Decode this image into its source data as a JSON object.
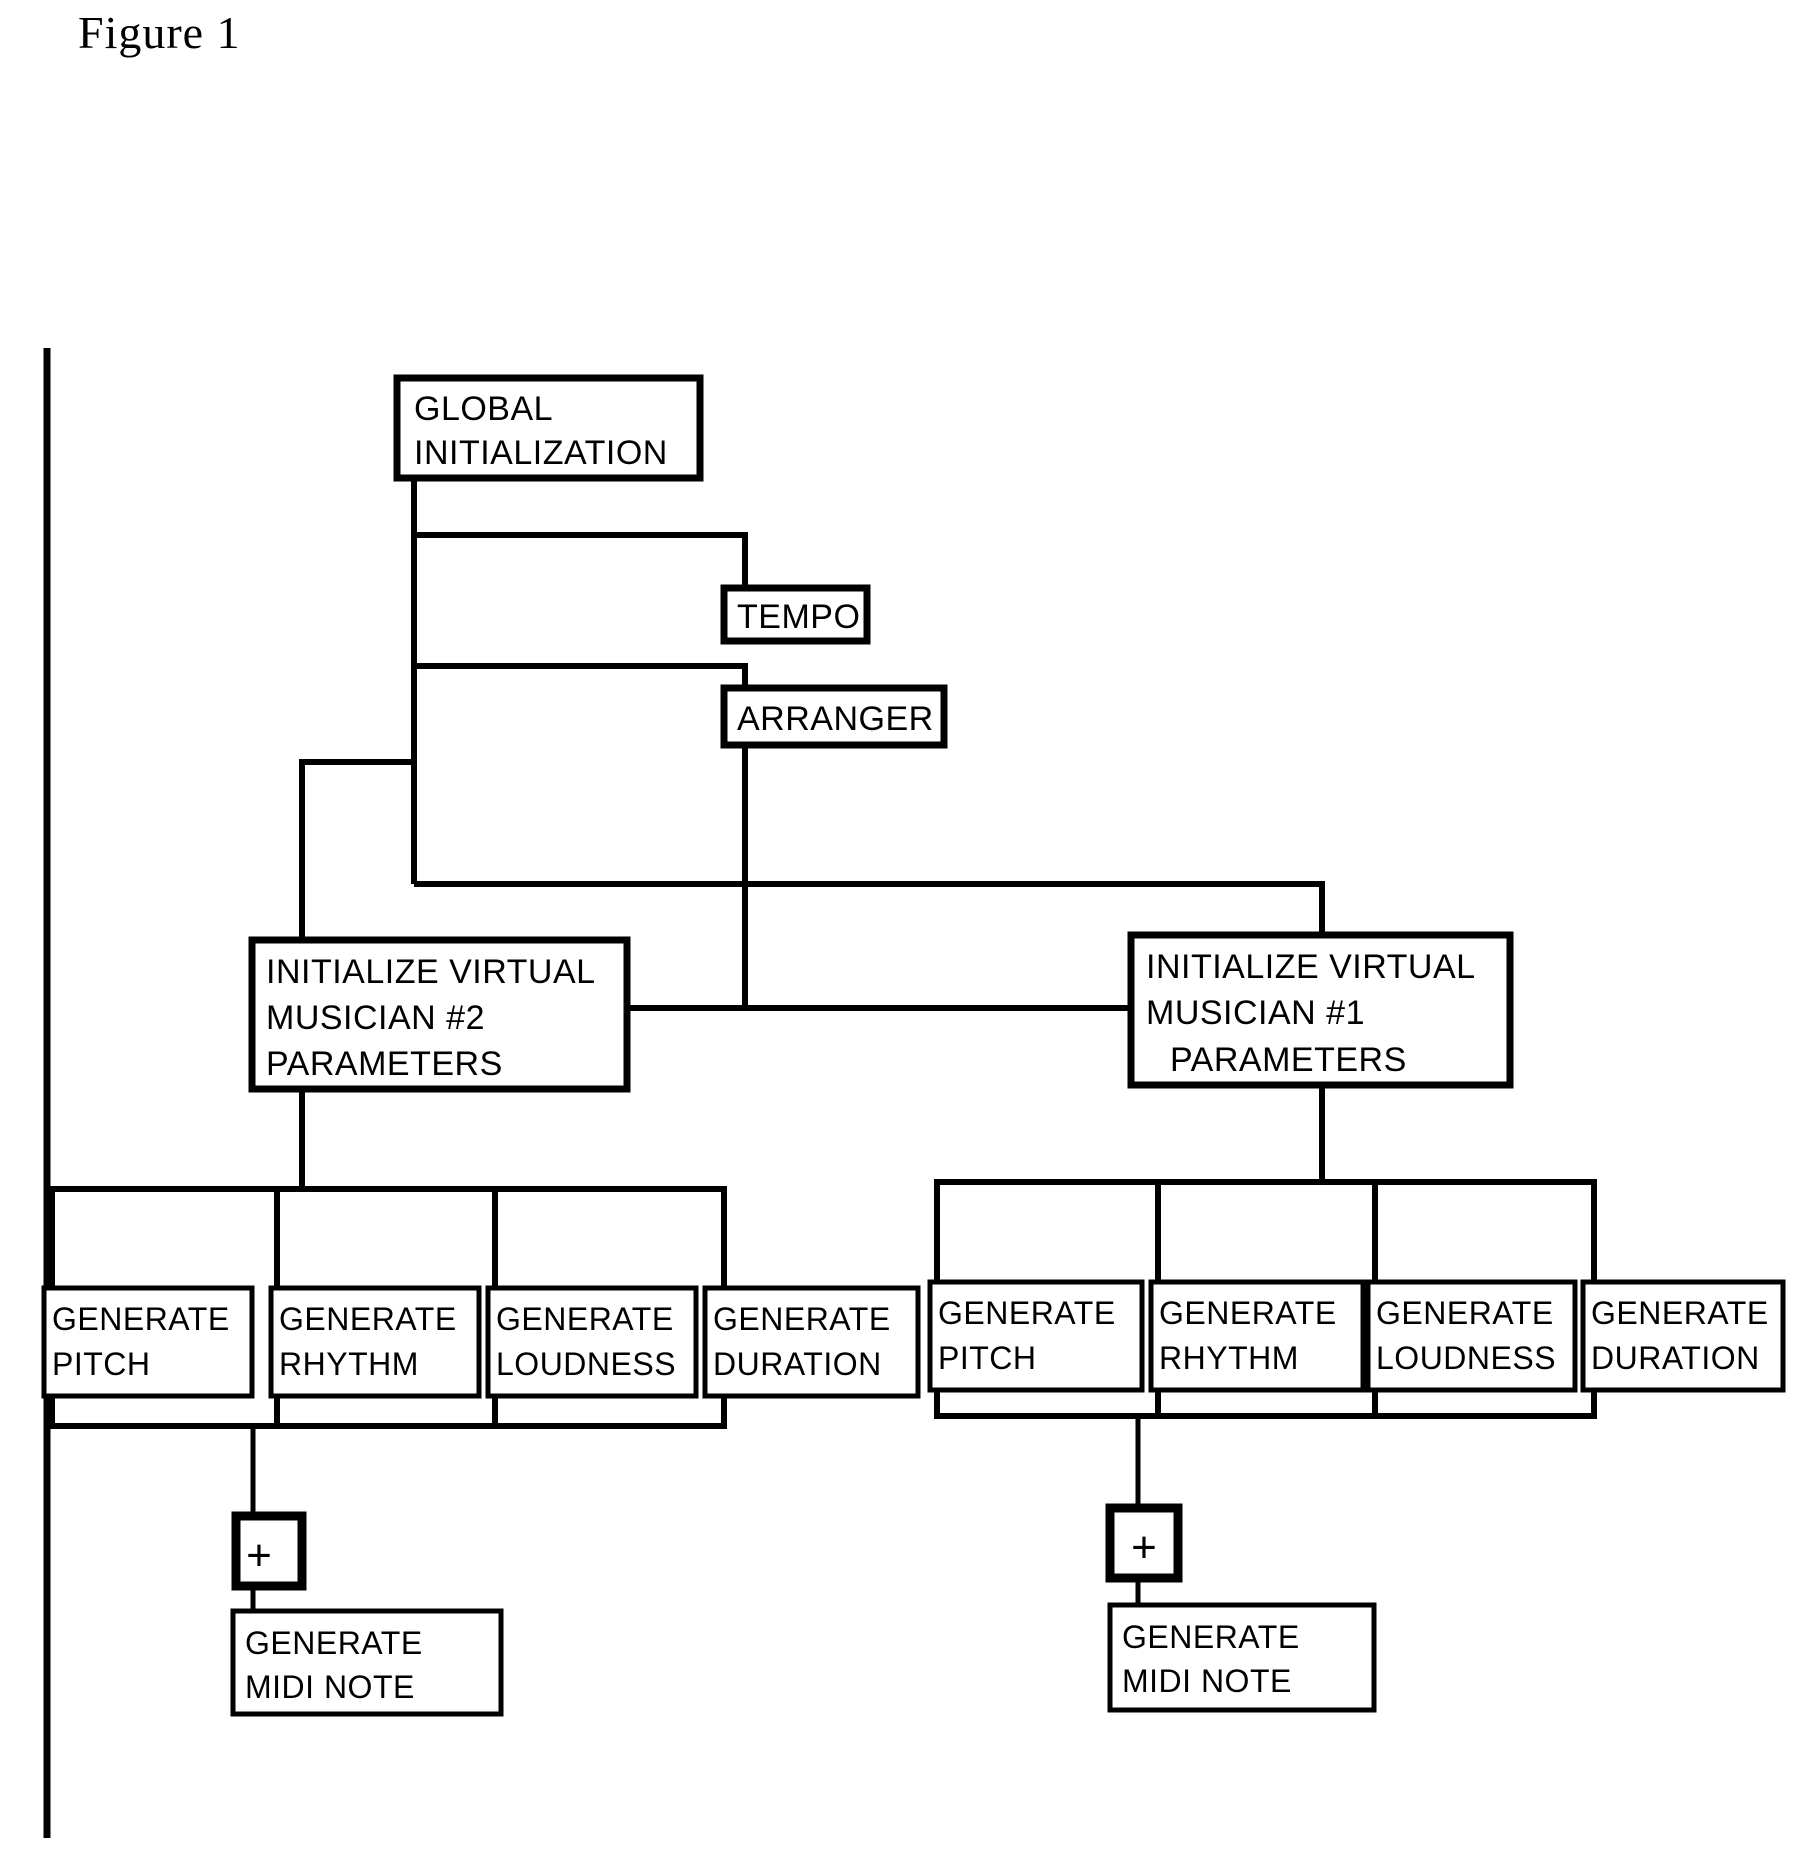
{
  "figure": {
    "title": "Figure 1",
    "ink_color": "#000000",
    "background_color": "#ffffff"
  },
  "nodes": {
    "global_initialization": {
      "line1": "GLOBAL",
      "line2": "INITIALIZATION"
    },
    "tempo": {
      "label": "TEMPO"
    },
    "arranger": {
      "label": "ARRANGER"
    },
    "init_vm2": {
      "line1": "INITIALIZE VIRTUAL",
      "line2": "MUSICIAN #2",
      "line3": "PARAMETERS"
    },
    "init_vm1": {
      "line1": "INITIALIZE VIRTUAL",
      "line2": "MUSICIAN #1",
      "line3": "PARAMETERS"
    },
    "generate_word": "GENERATE",
    "left_group": {
      "pitch": {
        "line1": "GENERATE",
        "line2": "PITCH"
      },
      "rhythm": {
        "line1": "GENERATE",
        "line2": "RHYTHM"
      },
      "loudness": {
        "line1": "GENERATE",
        "line2": "LOUDNESS"
      },
      "duration": {
        "line1": "GENERATE",
        "line2": "DURATION"
      },
      "summer": {
        "label": "+"
      },
      "midi_note": {
        "line1": "GENERATE",
        "line2": "MIDI NOTE"
      }
    },
    "right_group": {
      "pitch": {
        "line1": "GENERATE",
        "line2": "PITCH"
      },
      "rhythm": {
        "line1": "GENERATE",
        "line2": "RHYTHM"
      },
      "loudness": {
        "line1": "GENERATE",
        "line2": "LOUDNESS"
      },
      "duration": {
        "line1": "GENERATE",
        "line2": "DURATION"
      },
      "summer": {
        "label": "+"
      },
      "midi_note": {
        "line1": "GENERATE",
        "line2": "MIDI NOTE"
      }
    }
  }
}
